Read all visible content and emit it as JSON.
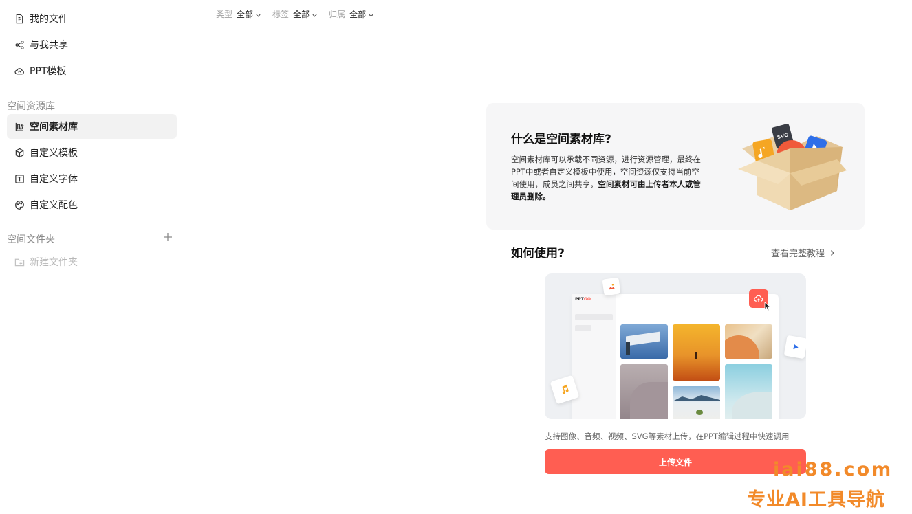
{
  "sidebar": {
    "top_items": [
      {
        "label": "我的文件",
        "icon": "file-icon"
      },
      {
        "label": "与我共享",
        "icon": "share-icon"
      },
      {
        "label": "PPT模板",
        "icon": "template-icon"
      }
    ],
    "space_library_title": "空间资源库",
    "space_items": [
      {
        "label": "空间素材库",
        "icon": "material-library-icon",
        "active": true
      },
      {
        "label": "自定义模板",
        "icon": "cube-icon"
      },
      {
        "label": "自定义字体",
        "icon": "font-icon"
      },
      {
        "label": "自定义配色",
        "icon": "palette-icon"
      }
    ],
    "space_folder_title": "空间文件夹",
    "new_folder_label": "新建文件夹"
  },
  "filters": [
    {
      "label": "类型",
      "value": "全部"
    },
    {
      "label": "标签",
      "value": "全部"
    },
    {
      "label": "归属",
      "value": "全部"
    }
  ],
  "info": {
    "title": "什么是空间素材库?",
    "desc_normal": "空间素材库可以承载不同资源，进行资源管理，最终在PPT中或者自定义模板中使用，空间资源仅支持当前空间使用，成员之间共享，",
    "desc_bold": "空间素材可由上传者本人或管理员删除。",
    "illustration_svg_label": "SVG"
  },
  "howto": {
    "title": "如何使用?",
    "tutorial_link": "查看完整教程",
    "demo_logo_prefix": "PPT",
    "demo_logo_suffix": "GO",
    "support_text": "支持图像、音频、视频、SVG等素材上传，在PPT编辑过程中快速调用",
    "upload_button": "上传文件"
  },
  "watermark": {
    "line1": "iai88.com",
    "line2": "专业AI工具导航"
  },
  "colors": {
    "accent": "#ff5e52",
    "watermark": "#f28a2a"
  }
}
